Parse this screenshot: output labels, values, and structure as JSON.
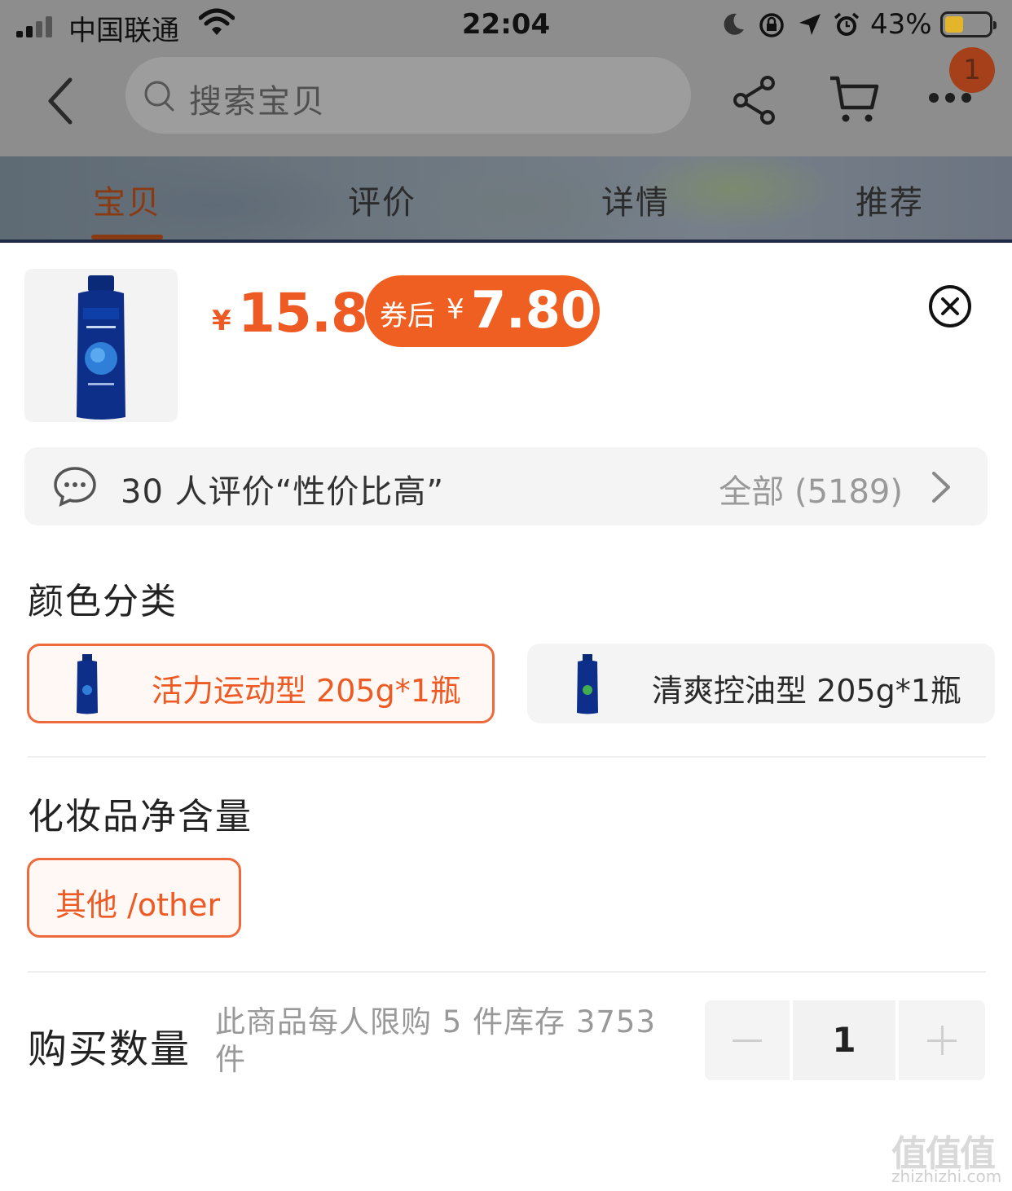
{
  "status_bar": {
    "carrier": "中国联通",
    "time": "22:04",
    "battery_percent": "43%",
    "battery_level": 0.43,
    "icons": [
      "signal-icon",
      "wifi-icon",
      "moon-icon",
      "orientation-lock-icon",
      "location-icon",
      "alarm-icon",
      "battery-icon"
    ]
  },
  "nav": {
    "search_placeholder": "搜索宝贝",
    "cart_badge": "1",
    "icons": [
      "back-icon",
      "search-icon",
      "share-icon",
      "cart-icon",
      "more-icon"
    ]
  },
  "tabs": [
    {
      "label": "宝贝",
      "active": true
    },
    {
      "label": "评价",
      "active": false
    },
    {
      "label": "详情",
      "active": false
    },
    {
      "label": "推荐",
      "active": false
    }
  ],
  "product": {
    "currency": "¥",
    "price": "15.8",
    "coupon_label": "券后",
    "coupon_currency": "¥",
    "coupon_price": "7.80"
  },
  "review_summary": {
    "text": "30 人评价“性价比高”",
    "all_label": "全部 (5189)"
  },
  "spec_groups": [
    {
      "title": "颜色分类",
      "options": [
        {
          "label": "活力运动型 205g*1瓶",
          "selected": true
        },
        {
          "label": "清爽控油型 205g*1瓶",
          "selected": false
        }
      ]
    },
    {
      "title": "化妆品净含量",
      "options": [
        {
          "label": "其他 /other",
          "selected": true
        }
      ]
    }
  ],
  "quantity": {
    "label": "购买数量",
    "note": "此商品每人限购 5 件库存 3753 件",
    "value": "1"
  },
  "watermark": {
    "brand": "值值值",
    "url": "zhizhizhi.com"
  },
  "colors": {
    "accent": "#ee5a24",
    "coupon_bg": "#ef5f22",
    "dim_overlay": "#8d8d8d",
    "active_tab": "#8a3a12",
    "bottle_blue": "#0d2f8a"
  }
}
